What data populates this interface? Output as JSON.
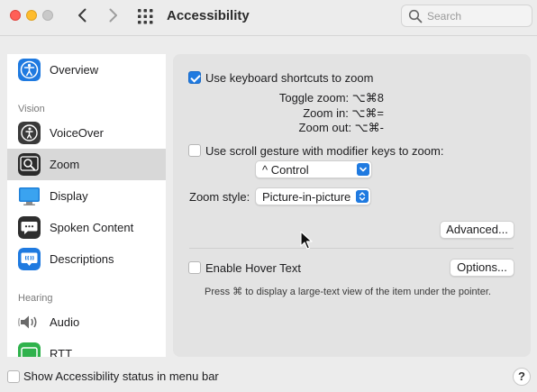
{
  "window": {
    "title": "Accessibility"
  },
  "toolbar": {
    "back_icon": "chevron-left-icon",
    "forward_icon": "chevron-right-icon",
    "grid_icon": "grid-icon"
  },
  "search": {
    "placeholder": "Search"
  },
  "colors": {
    "accent": "#1f7ae0",
    "close": "#ff5f57",
    "minimize": "#febc2e",
    "selection": "#d8d8d8"
  },
  "sidebar": {
    "items": [
      {
        "label": "Overview",
        "icon": "accessibility-icon",
        "selected": false
      },
      {
        "label": "VoiceOver",
        "icon": "voiceover-icon",
        "selected": false
      },
      {
        "label": "Zoom",
        "icon": "zoom-icon",
        "selected": true
      },
      {
        "label": "Display",
        "icon": "display-icon",
        "selected": false
      },
      {
        "label": "Spoken Content",
        "icon": "spoken-content-icon",
        "selected": false
      },
      {
        "label": "Descriptions",
        "icon": "descriptions-icon",
        "selected": false
      },
      {
        "label": "Audio",
        "icon": "audio-icon",
        "selected": false
      },
      {
        "label": "RTT",
        "icon": "rtt-icon",
        "selected": false
      }
    ],
    "sections": {
      "vision": "Vision",
      "hearing": "Hearing"
    }
  },
  "zoom": {
    "keyboard_shortcuts": {
      "label": "Use keyboard shortcuts to zoom",
      "checked": true,
      "toggle": "Toggle zoom: ⌥⌘8",
      "zoom_in": "Zoom in: ⌥⌘=",
      "zoom_out": "Zoom out: ⌥⌘-"
    },
    "scroll_gesture": {
      "label": "Use scroll gesture with modifier keys to zoom:",
      "checked": false,
      "modifier": "^ Control"
    },
    "style": {
      "label": "Zoom style:",
      "value": "Picture-in-picture"
    },
    "advanced_button": "Advanced...",
    "hover_text": {
      "label": "Enable Hover Text",
      "checked": false,
      "options_button": "Options...",
      "hint": "Press ⌘ to display a large-text view of the item under the pointer."
    }
  },
  "footer": {
    "status_menu": {
      "label": "Show Accessibility status in menu bar",
      "checked": false
    },
    "help": "?"
  }
}
